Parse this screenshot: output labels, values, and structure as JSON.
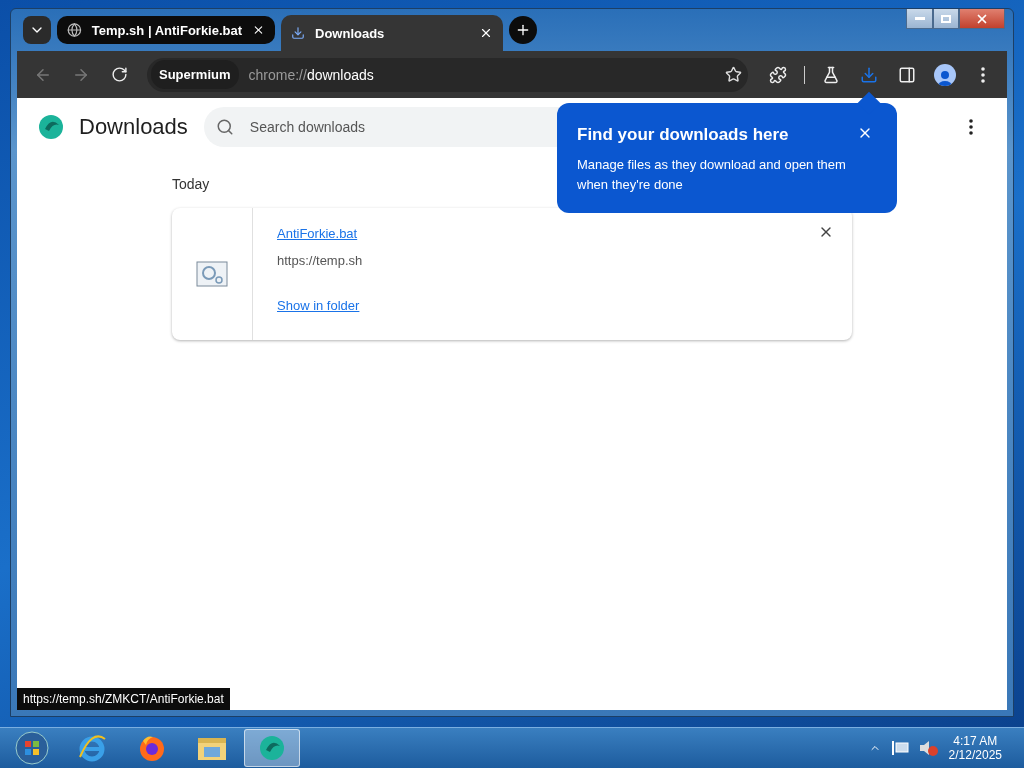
{
  "tabs": [
    {
      "title": "Temp.sh | AntiForkie.bat",
      "selected": false
    },
    {
      "title": "Downloads",
      "selected": true
    }
  ],
  "toolbar": {
    "chip": "Supermium",
    "url_scheme": "chrome://",
    "url_path": "downloads"
  },
  "page": {
    "title": "Downloads",
    "search": {
      "placeholder": "Search downloads"
    },
    "section": "Today",
    "item": {
      "name": "AntiForkie.bat",
      "source": "https://temp.sh",
      "action": "Show in folder"
    }
  },
  "bubble": {
    "title": "Find your downloads here",
    "body": "Manage files as they download and open them when they're done"
  },
  "status_url": "https://temp.sh/ZMKCT/AntiForkie.bat",
  "taskbar": {
    "apps": [
      {
        "selected": false
      },
      {
        "selected": false
      },
      {
        "selected": false
      },
      {
        "selected": false
      },
      {
        "selected": true
      }
    ],
    "time": "4:17 AM",
    "date": "2/12/2025"
  }
}
